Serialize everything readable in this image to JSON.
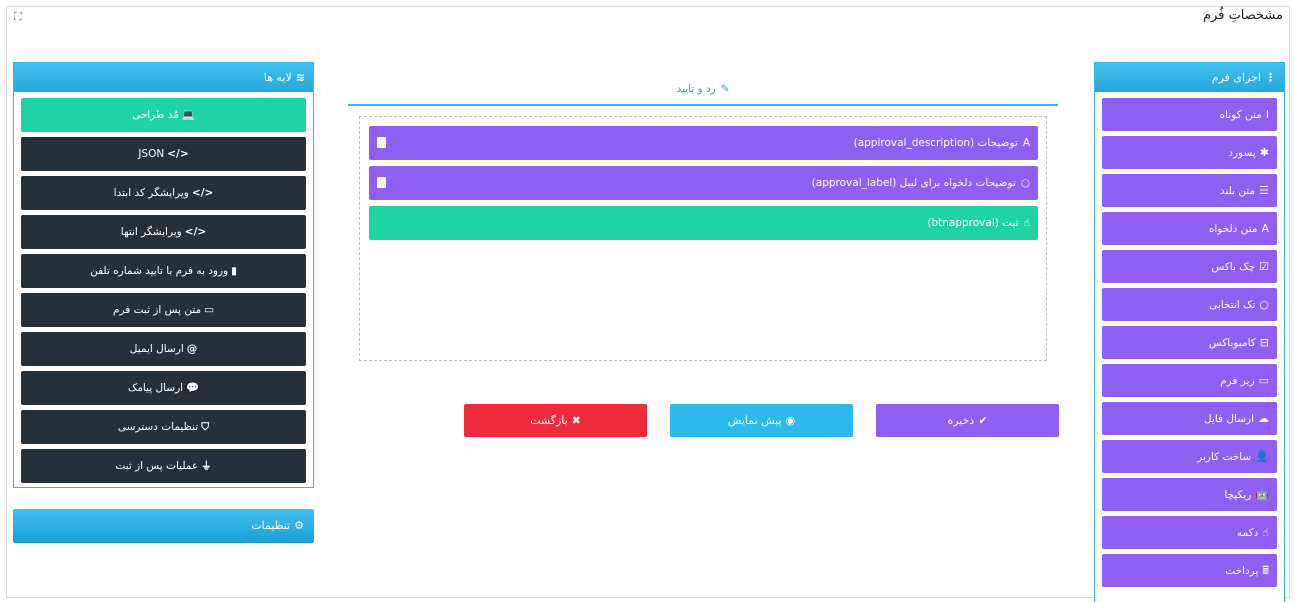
{
  "header": {
    "title": "مشخصاتِ فُرم",
    "expand_icon": "expand-icon"
  },
  "elements_panel": {
    "title": "اجزای فرم",
    "icon": "list-icon",
    "items": [
      {
        "label": "متن کوتاه",
        "icon": "I"
      },
      {
        "label": "پسورد",
        "icon": "✱"
      },
      {
        "label": "متن بلند",
        "icon": "☰"
      },
      {
        "label": "متن دلخواه",
        "icon": "A"
      },
      {
        "label": "چک باکس",
        "icon": "☑"
      },
      {
        "label": "تک انتخابی",
        "icon": "○"
      },
      {
        "label": "کامبوباکس",
        "icon": "⊟"
      },
      {
        "label": "زیر فرم",
        "icon": "▭"
      },
      {
        "label": "ارسال فایل",
        "icon": "☁"
      },
      {
        "label": "ساخت کاربر",
        "icon": "👤"
      },
      {
        "label": "ریکپچا",
        "icon": "🤖"
      },
      {
        "label": "دکمه",
        "icon": "☝"
      },
      {
        "label": "پرداخت",
        "icon": "🖩"
      }
    ]
  },
  "layers_panel": {
    "title": "لایه ها",
    "icon": "layers-icon",
    "items": [
      {
        "label": "مُد طراحی",
        "icon": "💻",
        "active": true
      },
      {
        "label": "JSON",
        "icon": "</>",
        "active": false
      },
      {
        "label": "ویرایشگر کد ابتدا",
        "icon": "</>",
        "active": false
      },
      {
        "label": "ویرایشگر انتها",
        "icon": "</>",
        "active": false
      },
      {
        "label": "ورود به فرم با تایید شماره تلفن",
        "icon": "▮",
        "active": false
      },
      {
        "label": "متن پس از ثبت فرم",
        "icon": "▭",
        "active": false
      },
      {
        "label": "ارسال ایمیل",
        "icon": "@",
        "active": false
      },
      {
        "label": "ارسال پیامک",
        "icon": "💬",
        "active": false
      },
      {
        "label": "تنظیمات دسترسی",
        "icon": "⛉",
        "active": false
      },
      {
        "label": "عملیات پس از ثبت",
        "icon": "⏚",
        "active": false
      }
    ]
  },
  "settings_panel": {
    "label": "تنظیمات",
    "icon": "⚙"
  },
  "center": {
    "tab_label": "رد و تایید",
    "tab_icon": "✎",
    "fields": [
      {
        "label": "توضیحات (appiroval_description)",
        "icon": "A",
        "color": "purple",
        "has_handle": true
      },
      {
        "label": "توضیحات دلخواه برای لیبل (approval_label)",
        "icon": "○",
        "color": "purple",
        "has_handle": true
      },
      {
        "label": "ثبت (btnapproval)",
        "icon": "☝",
        "color": "green",
        "has_handle": false
      }
    ]
  },
  "buttons": {
    "save": {
      "label": "ذخیره",
      "icon": "✔"
    },
    "preview": {
      "label": "پیش نمایش",
      "icon": "◉"
    },
    "back": {
      "label": "بازگشت",
      "icon": "✖"
    }
  },
  "colors": {
    "purple": "#8e5ff0",
    "green": "#1fd3a2",
    "dark": "#263038",
    "blue": "#2cb9ec",
    "red": "#ee2a3f"
  }
}
